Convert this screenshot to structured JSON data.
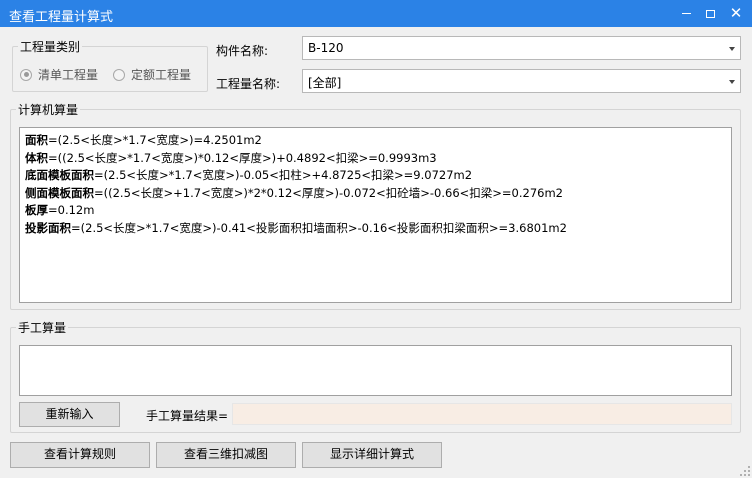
{
  "window": {
    "title": "查看工程量计算式",
    "minimize_icon": "minimize-icon",
    "maximize_icon": "maximize-icon",
    "close_icon": "close-icon",
    "title_bar_color": "#2b82e6"
  },
  "quantity_category": {
    "title": "工程量类别",
    "options": [
      {
        "label": "清单工程量",
        "checked": true
      },
      {
        "label": "定额工程量",
        "checked": false
      }
    ]
  },
  "component": {
    "label": "构件名称:",
    "value": "B-120"
  },
  "quantity_name": {
    "label": "工程量名称:",
    "value": "[全部]"
  },
  "computer_calc": {
    "title": "计算机算量",
    "lines": [
      {
        "name": "面积",
        "expr": "=(2.5<长度>*1.7<宽度>)=4.2501m2"
      },
      {
        "name": "体积",
        "expr": "=((2.5<长度>*1.7<宽度>)*0.12<厚度>)+0.4892<扣梁>=0.9993m3"
      },
      {
        "name": "底面模板面积",
        "expr": "=(2.5<长度>*1.7<宽度>)-0.05<扣柱>+4.8725<扣梁>=9.0727m2"
      },
      {
        "name": "侧面模板面积",
        "expr": "=((2.5<长度>+1.7<宽度>)*2*0.12<厚度>)-0.072<扣砼墙>-0.66<扣梁>=0.276m2"
      },
      {
        "name": "板厚",
        "expr": "=0.12m"
      },
      {
        "name": "投影面积",
        "expr": "=(2.5<长度>*1.7<宽度>)-0.41<投影面积扣墙面积>-0.16<投影面积扣梁面积>=3.6801m2"
      }
    ]
  },
  "manual_calc": {
    "title": "手工算量",
    "input_value": "",
    "reenter_label": "重新输入",
    "result_label": "手工算量结果=",
    "result_value": "",
    "result_bg": "#f8ede4"
  },
  "bottom_buttons": {
    "view_rules": "查看计算规则",
    "view_3d": "查看三维扣减图",
    "show_detail": "显示详细计算式"
  }
}
